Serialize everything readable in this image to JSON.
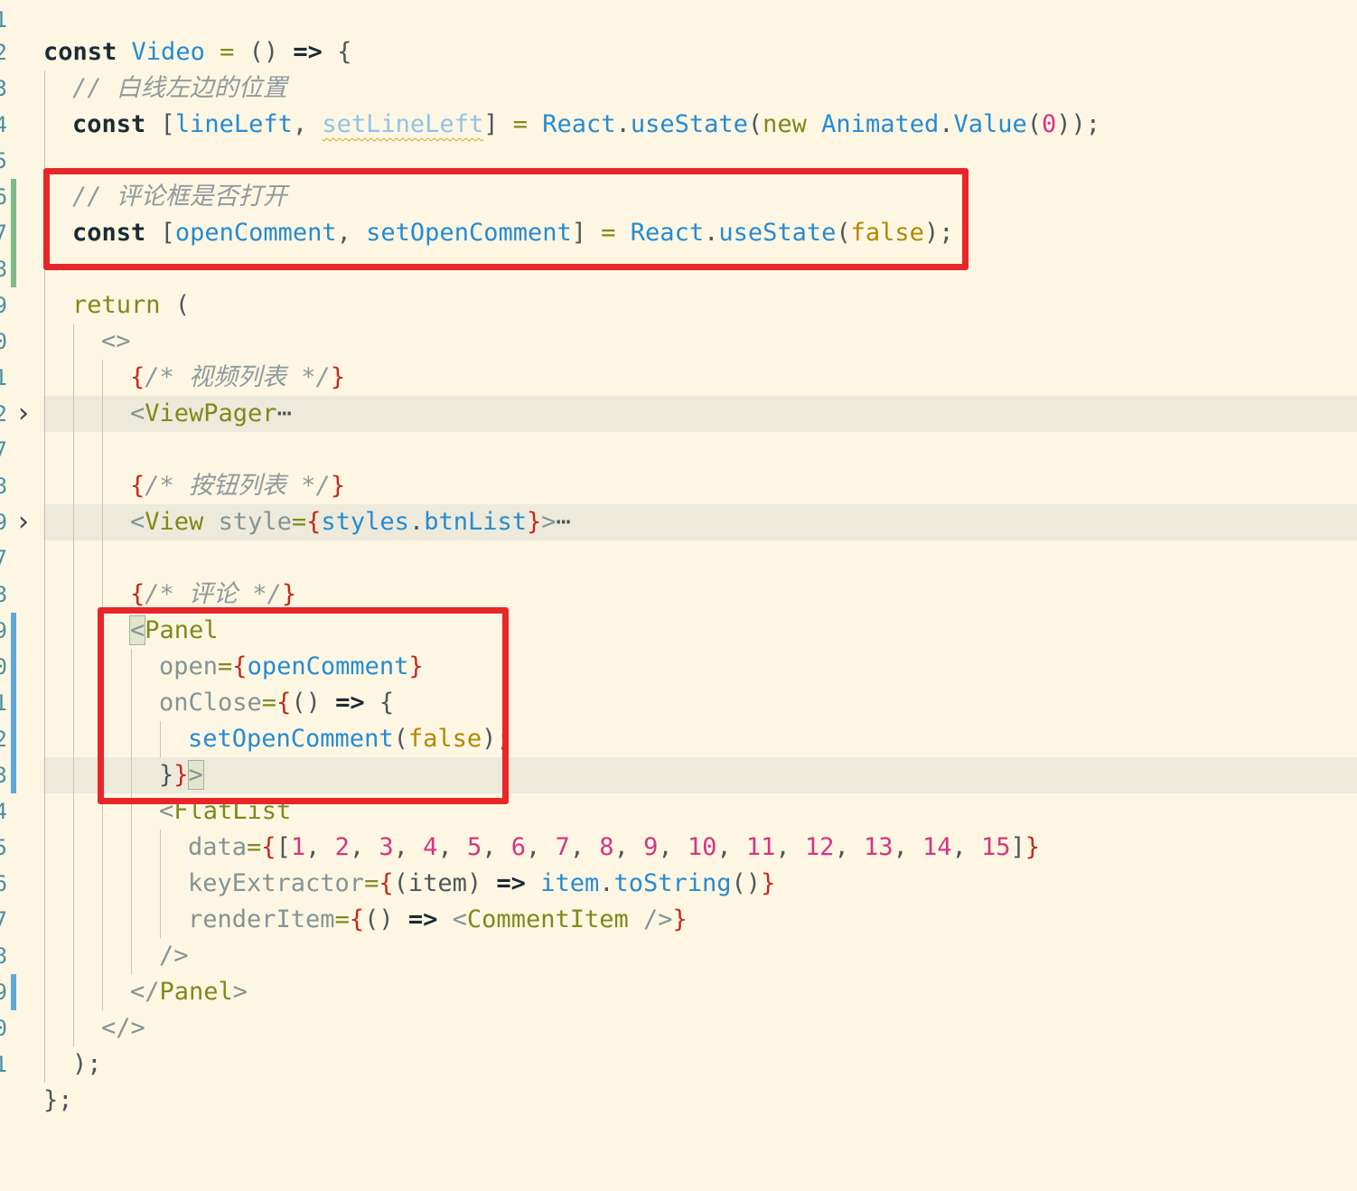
{
  "gutter": [
    "1",
    "2",
    "3",
    "4",
    "5",
    "6",
    "7",
    "8",
    "9",
    "0",
    "0",
    "1",
    "2",
    "7",
    "8",
    "9",
    "7",
    "8",
    "9",
    "0",
    "1",
    "2",
    "3",
    "4",
    "5",
    "6",
    "7",
    "8",
    "9",
    "0",
    "1"
  ],
  "code": {
    "l1": {
      "kw": "const",
      "name": "Video",
      "eq": "=",
      "params": "()",
      "arrow": "=>",
      "open": "{"
    },
    "l2": {
      "comment": "// 白线左边的位置"
    },
    "l3": {
      "kw": "const",
      "open": "[",
      "a": "lineLeft",
      "comma": ",",
      "b": "setLineLeft",
      "close": "]",
      "eq": "=",
      "obj": "React",
      "dot": ".",
      "fn": "useState",
      "p1": "(",
      "new": "new",
      "cls": "Animated",
      "dot2": ".",
      "val": "Value",
      "p2": "(",
      "num": "0",
      "tail": "));"
    },
    "l4": {
      "comment": "// 评论框是否打开"
    },
    "l5": {
      "kw": "const",
      "open": "[",
      "a": "openComment",
      "comma": ",",
      "b": "setOpenComment",
      "close": "]",
      "eq": "=",
      "obj": "React",
      "dot": ".",
      "fn": "useState",
      "p1": "(",
      "bool": "false",
      "tail": ");"
    },
    "l6": {
      "kw": "return",
      "paren": "("
    },
    "l7": {
      "frag": "<>"
    },
    "l8": {
      "b1": "{",
      "c": "/* 视频列表 */",
      "b2": "}"
    },
    "l9": {
      "lt": "<",
      "tag": "ViewPager",
      "dots": "⋯"
    },
    "l10": {
      "b1": "{",
      "c": "/* 按钮列表 */",
      "b2": "}"
    },
    "l11": {
      "lt": "<",
      "tag": "View",
      "attr": "style",
      "eq": "=",
      "b1": "{",
      "v1": "styles",
      "dot": ".",
      "v2": "btnList",
      "b2": "}",
      "gt": ">",
      "dots": "⋯"
    },
    "l12": {
      "b1": "{",
      "c": "/* 评论 */",
      "b2": "}"
    },
    "l13": {
      "lt": "<",
      "tag": "Panel"
    },
    "l14": {
      "attr": "open",
      "eq": "=",
      "b1": "{",
      "v": "openComment",
      "b2": "}"
    },
    "l15": {
      "attr": "onClose",
      "eq": "=",
      "b1": "{",
      "params": "()",
      "arrow": "=>",
      "open": "{"
    },
    "l16": {
      "fn": "setOpenComment",
      "p1": "(",
      "bool": "false",
      "tail": ");"
    },
    "l17": {
      "close": "}",
      "b2": "}",
      "gt": ">"
    },
    "l18": {
      "lt": "<",
      "tag": "FlatList"
    },
    "l19": {
      "attr": "data",
      "eq": "=",
      "b1": "{",
      "open": "[",
      "nums": [
        "1",
        "2",
        "3",
        "4",
        "5",
        "6",
        "7",
        "8",
        "9",
        "10",
        "11",
        "12",
        "13",
        "14",
        "15"
      ],
      "close": "]",
      "b2": "}"
    },
    "l20": {
      "attr": "keyExtractor",
      "eq": "=",
      "b1": "{",
      "p": "(item)",
      "arrow": "=>",
      "v": "item",
      "dot": ".",
      "fn": "toString",
      "call": "()",
      "b2": "}"
    },
    "l21": {
      "attr": "renderItem",
      "eq": "=",
      "b1": "{",
      "params": "()",
      "arrow": "=>",
      "lt": "<",
      "tag": "CommentItem",
      "end": "/>",
      "b2": "}"
    },
    "l22": {
      "end": "/>"
    },
    "l23": {
      "lt": "</",
      "tag": "Panel",
      "gt": ">"
    },
    "l24": {
      "frag": "</>"
    },
    "l25": {
      "tail": ");"
    },
    "l26": {
      "tail": "};"
    }
  },
  "colors": {
    "highlight_box": "#e8262a",
    "git_added": "#7dbb8a",
    "git_modified": "#5ea9d8",
    "background": "#fdf6e3"
  }
}
